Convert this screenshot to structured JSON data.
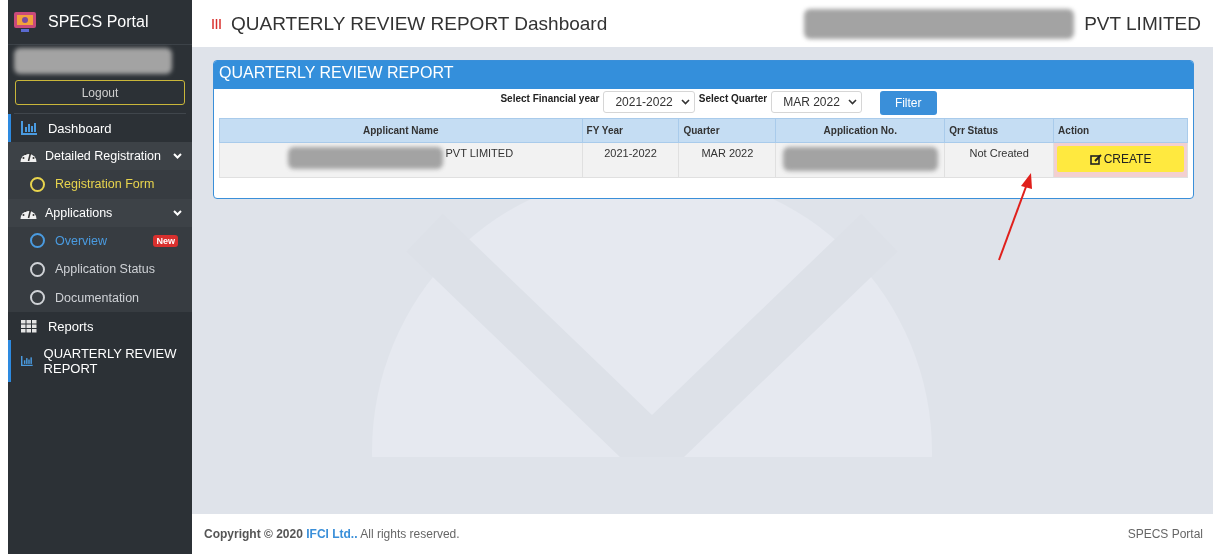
{
  "sidebar": {
    "brand": "SPECS Portal",
    "logout": "Logout",
    "items": [
      {
        "kind": "chart",
        "label": "Dashboard",
        "active": true
      },
      {
        "kind": "group",
        "label": "Detailed Registration",
        "expanded": true,
        "children": [
          {
            "label": "Registration Form",
            "color": "#e8d44d"
          }
        ]
      },
      {
        "kind": "group",
        "label": "Applications",
        "expanded": true,
        "children": [
          {
            "label": "Overview",
            "color": "#4a9be0",
            "badge": "New"
          },
          {
            "label": "Application Status",
            "color": "#cfd2d6"
          },
          {
            "label": "Documentation",
            "color": "#cfd2d6"
          }
        ]
      },
      {
        "kind": "grid",
        "label": "Reports",
        "active": false
      },
      {
        "kind": "chart",
        "label": "QUARTERLY REVIEW REPORT",
        "active": true
      }
    ]
  },
  "header": {
    "title": "QUARTERLY REVIEW REPORT Dashboard",
    "company": "PVT LIMITED"
  },
  "card": {
    "title": "QUARTERLY REVIEW REPORT",
    "filters": [
      {
        "label": "Select Financial year",
        "value": "2021-2022"
      },
      {
        "label": "Select Quarter",
        "value": "MAR 2022"
      }
    ],
    "filter_button": "Filter",
    "table": {
      "columns": [
        "Applicant Name",
        "FY Year",
        "Quarter",
        "Application No.",
        "Qrr Status",
        "Action"
      ],
      "rows": [
        {
          "applicant": "PVT LIMITED",
          "fy_year": "2021-2022",
          "quarter": "MAR 2022",
          "status": "Not Created",
          "action": "CREATE"
        }
      ]
    }
  },
  "footer": {
    "prefix": "Copyright © 2020",
    "link": "IFCI Ltd..",
    "suffix": "All rights reserved.",
    "right": "SPECS Portal"
  }
}
